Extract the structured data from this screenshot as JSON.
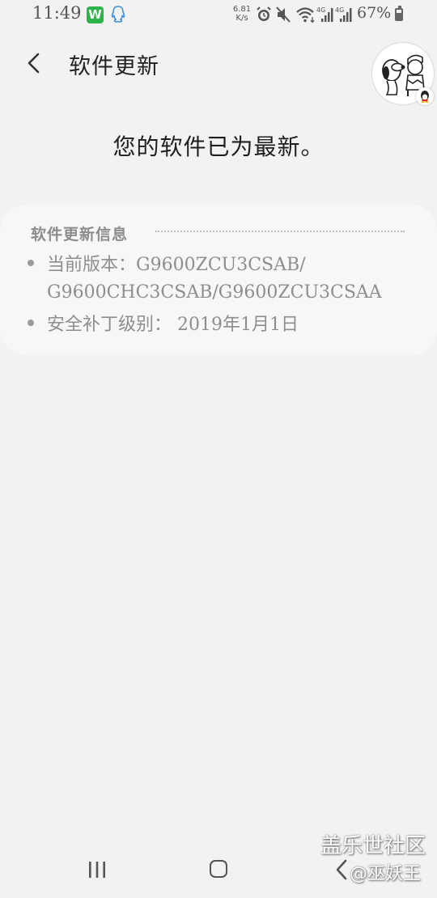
{
  "status_bar": {
    "time": "11:49",
    "app_w": "W",
    "speed_value": "6.81",
    "speed_unit": "K/s",
    "battery_text": "67%",
    "battery_level": 0.67,
    "icons": [
      "wechat-work-icon",
      "qq-icon",
      "alarm-icon",
      "mute-icon",
      "wifi-icon",
      "4g-signal-icon",
      "4g-signal-icon",
      "battery-icon"
    ]
  },
  "header": {
    "back_icon": "chevron-left-icon",
    "title": "软件更新"
  },
  "main": {
    "message": "您的软件已为最新。"
  },
  "info_card": {
    "title": "软件更新信息",
    "items": [
      {
        "text": "当前版本：G9600ZCU3CSAB/",
        "continuation": "G9600CHC3CSAB/G9600ZCU3CSAA"
      },
      {
        "text": "安全补丁级别： 2019年1月1日"
      }
    ]
  },
  "nav_bar": {
    "icons": [
      "recent-apps-icon",
      "home-icon",
      "back-icon"
    ]
  },
  "watermark": {
    "title": "盖乐世社区",
    "user": "@巫妖王"
  },
  "colors": {
    "background": "#f2f2f2",
    "card": "#f7f7f7",
    "text_primary": "#222222",
    "text_secondary": "#8e8e8e",
    "wechat_work_green": "#2db34a"
  }
}
